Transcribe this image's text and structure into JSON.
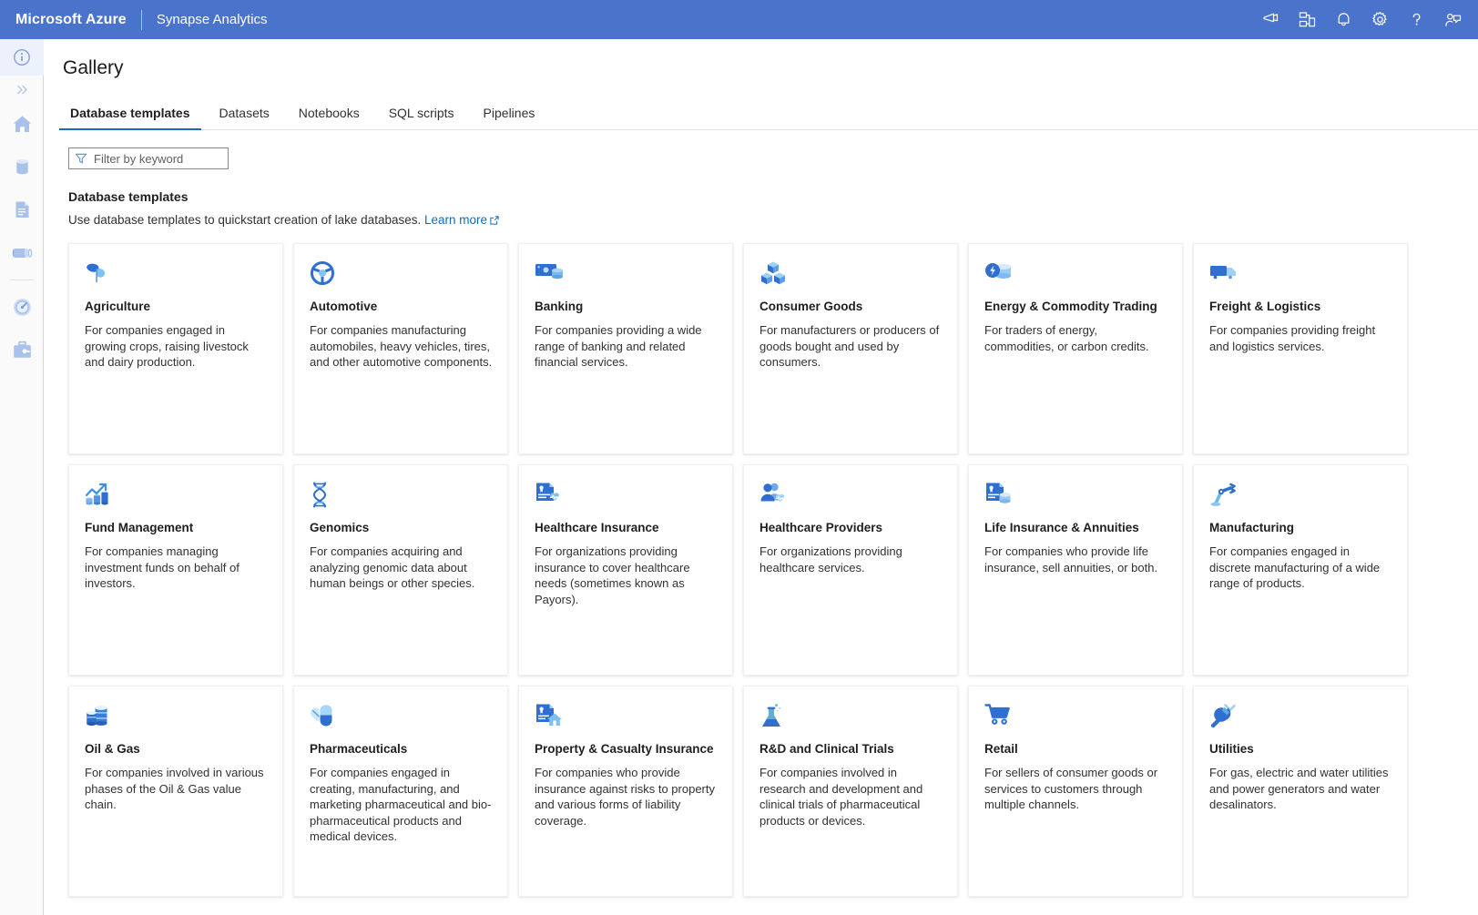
{
  "topbar": {
    "brand": "Microsoft Azure",
    "product": "Synapse Analytics",
    "icons": [
      {
        "name": "announcements-icon",
        "label": "Announcements"
      },
      {
        "name": "workspaces-icon",
        "label": "Workspaces"
      },
      {
        "name": "notifications-bell-icon",
        "label": "Notifications"
      },
      {
        "name": "settings-gear-icon",
        "label": "Settings"
      },
      {
        "name": "help-question-icon",
        "label": "Help"
      },
      {
        "name": "feedback-person-icon",
        "label": "Feedback"
      }
    ]
  },
  "sidebar": {
    "items": [
      {
        "name": "info-icon",
        "label": "Info"
      },
      {
        "name": "chevron-double-right-icon",
        "label": "Expand"
      },
      {
        "name": "home-icon",
        "label": "Home"
      },
      {
        "name": "data-cylinder-icon",
        "label": "Data"
      },
      {
        "name": "develop-document-icon",
        "label": "Develop"
      },
      {
        "name": "integrate-pipeline-icon",
        "label": "Integrate"
      },
      {
        "name": "monitor-gauge-icon",
        "label": "Monitor"
      },
      {
        "name": "manage-toolbox-icon",
        "label": "Manage"
      }
    ]
  },
  "page": {
    "title": "Gallery"
  },
  "tabs": [
    {
      "label": "Database templates",
      "active": true
    },
    {
      "label": "Datasets",
      "active": false
    },
    {
      "label": "Notebooks",
      "active": false
    },
    {
      "label": "SQL scripts",
      "active": false
    },
    {
      "label": "Pipelines",
      "active": false
    }
  ],
  "filter": {
    "placeholder": "Filter by keyword",
    "value": ""
  },
  "section": {
    "title": "Database templates",
    "description": "Use database templates to quickstart creation of lake databases.",
    "link_label": "Learn more"
  },
  "colors": {
    "topbar": "#4a73cb",
    "accent": "#2266cc",
    "link": "#0f6cbd",
    "icon_blue_dark": "#2b6cd1",
    "icon_blue_mid": "#4f8ce8",
    "icon_blue_light": "#8fc3f5"
  },
  "cards": [
    {
      "icon": "leaf-icon",
      "title": "Agriculture",
      "desc": "For companies engaged in growing crops, raising livestock and dairy production."
    },
    {
      "icon": "steering-wheel-icon",
      "title": "Automotive",
      "desc": "For companies manufacturing automobiles, heavy vehicles, tires, and other automotive components."
    },
    {
      "icon": "cash-money-icon",
      "title": "Banking",
      "desc": "For companies providing a wide range of banking and related financial services."
    },
    {
      "icon": "boxes-stack-icon",
      "title": "Consumer Goods",
      "desc": "For manufacturers or producers of goods bought and used by consumers."
    },
    {
      "icon": "energy-bolt-coins-icon",
      "title": "Energy & Commodity Trading",
      "desc": "For traders of energy, commodities, or carbon credits."
    },
    {
      "icon": "delivery-truck-icon",
      "title": "Freight & Logistics",
      "desc": "For companies providing freight and logistics services."
    },
    {
      "icon": "growth-chart-coins-icon",
      "title": "Fund Management",
      "desc": "For companies managing investment funds on behalf of investors."
    },
    {
      "icon": "dna-helix-icon",
      "title": "Genomics",
      "desc": "For companies acquiring and analyzing genomic data about human beings or other species."
    },
    {
      "icon": "id-card-heartbeat-icon",
      "title": "Healthcare Insurance",
      "desc": "For organizations providing insurance to cover healthcare needs (sometimes known as Payors)."
    },
    {
      "icon": "people-heartbeat-icon",
      "title": "Healthcare Providers",
      "desc": "For organizations providing healthcare services."
    },
    {
      "icon": "id-card-coins-icon",
      "title": "Life Insurance & Annuities",
      "desc": "For companies who provide life insurance, sell annuities, or both."
    },
    {
      "icon": "robot-arm-icon",
      "title": "Manufacturing",
      "desc": "For companies engaged in discrete manufacturing of a wide range of products."
    },
    {
      "icon": "oil-barrels-icon",
      "title": "Oil & Gas",
      "desc": "For companies involved in various phases of the Oil & Gas value chain."
    },
    {
      "icon": "pill-capsule-icon",
      "title": "Pharmaceuticals",
      "desc": "For companies engaged in creating, manufacturing, and marketing pharmaceutical and bio-pharmaceutical products and medical devices."
    },
    {
      "icon": "id-card-house-icon",
      "title": "Property & Casualty Insurance",
      "desc": "For companies who provide insurance against risks to property and various forms of liability coverage."
    },
    {
      "icon": "flask-icon",
      "title": "R&D and Clinical Trials",
      "desc": "For companies involved in research and development and clinical trials of pharmaceutical products or devices."
    },
    {
      "icon": "shopping-cart-icon",
      "title": "Retail",
      "desc": "For sellers of consumer goods or services to customers through multiple channels."
    },
    {
      "icon": "power-plug-icon",
      "title": "Utilities",
      "desc": "For gas, electric and water utilities and power generators and water desalinators."
    }
  ]
}
